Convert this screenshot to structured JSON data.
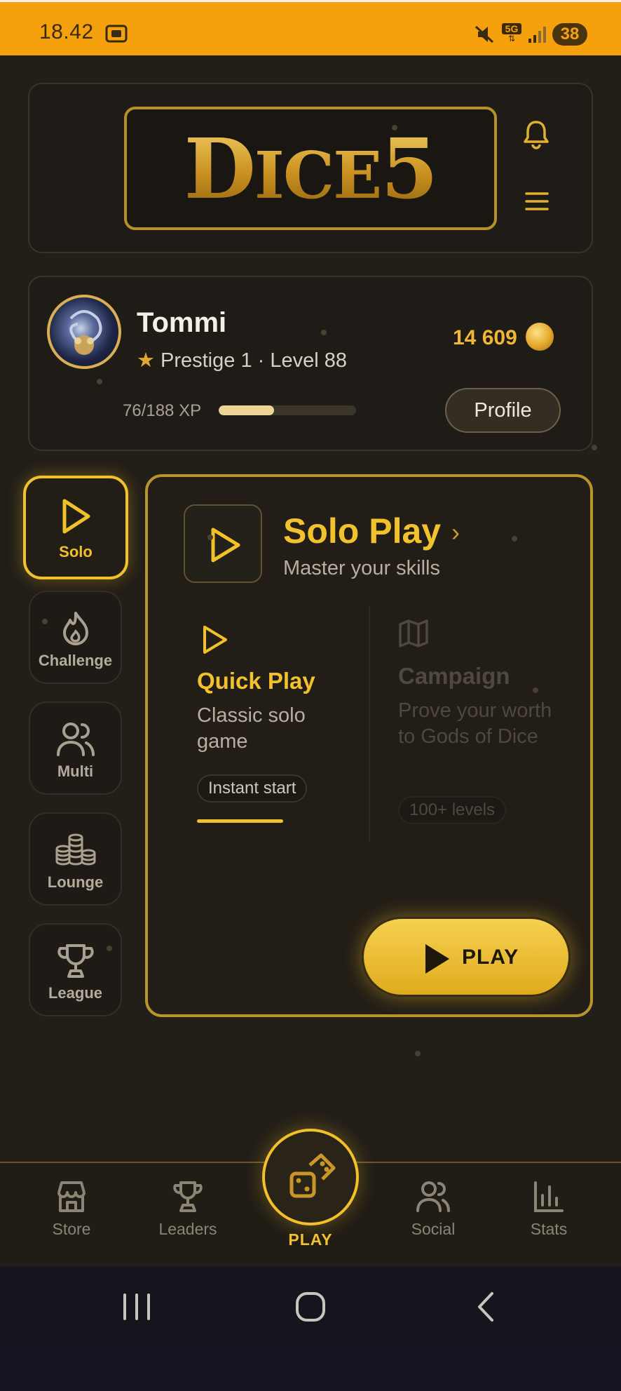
{
  "status_bar": {
    "time": "18.42",
    "network": "5G",
    "battery": "38",
    "icons": [
      "screenshot-icon",
      "mute-icon",
      "5g-data-icon",
      "signal-icon",
      "battery-icon"
    ]
  },
  "header": {
    "logo": "DICE5",
    "icons": [
      "bell-icon",
      "menu-icon"
    ]
  },
  "profile": {
    "name": "Tommi",
    "star": "★",
    "prestige_level": "Prestige 1 · Level 88",
    "coins": "14 609",
    "xp_text": "76/188 XP",
    "xp_progress": 0.404,
    "profile_button": "Profile"
  },
  "modes": [
    {
      "label": "Solo",
      "icon": "play-icon",
      "active": true
    },
    {
      "label": "Challenge",
      "icon": "flame-icon",
      "active": false
    },
    {
      "label": "Multi",
      "icon": "users-icon",
      "active": false
    },
    {
      "label": "Lounge",
      "icon": "coin-stacks-icon",
      "active": false
    },
    {
      "label": "League",
      "icon": "trophy-icon",
      "active": false
    }
  ],
  "panel": {
    "title": "Solo Play",
    "chevron": "›",
    "subtitle": "Master your skills",
    "quick_play": {
      "title": "Quick Play",
      "description": "Classic solo game",
      "chip": "Instant start",
      "selected": true
    },
    "campaign": {
      "title": "Campaign",
      "description": "Prove your worth to Gods of Dice",
      "chip": "100+ levels",
      "enabled": false
    },
    "play_button": "PLAY"
  },
  "bottom_nav": {
    "items": [
      {
        "label": "Store",
        "icon": "store-icon"
      },
      {
        "label": "Leaders",
        "icon": "trophy-icon"
      },
      {
        "label": "PLAY",
        "icon": "dice-icon"
      },
      {
        "label": "Social",
        "icon": "users-icon"
      },
      {
        "label": "Stats",
        "icon": "bar-chart-icon"
      }
    ]
  },
  "colors": {
    "status_bar": "#f5a10e",
    "background": "#221e18",
    "accent": "#f2c02a",
    "muted_text": "#b8afa0",
    "disabled_text": "#4e483e"
  }
}
